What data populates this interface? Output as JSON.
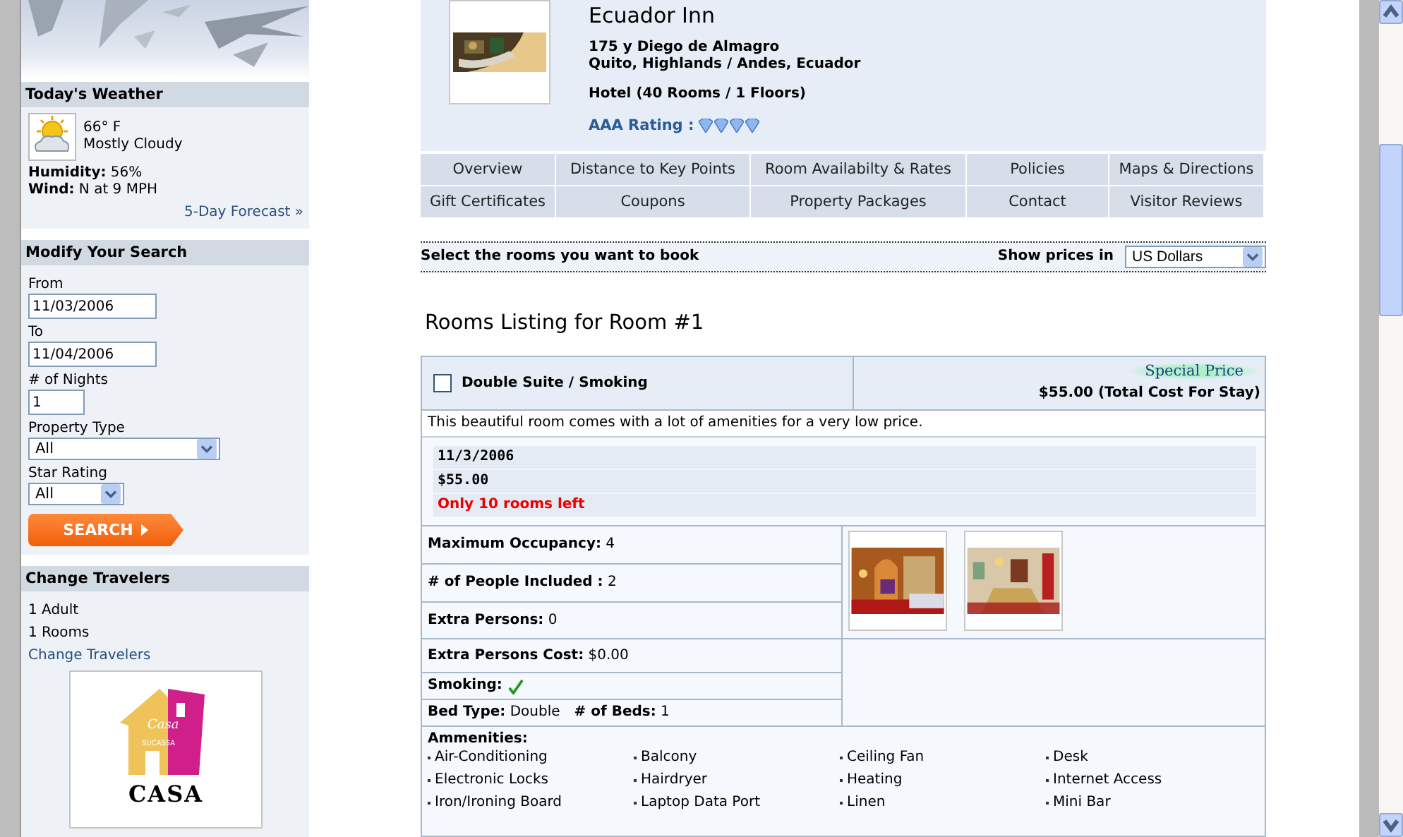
{
  "sidebar": {
    "weather": {
      "title": "Today's Weather",
      "temperature": "66° F",
      "condition": "Mostly Cloudy",
      "humidity_label": "Humidity:",
      "humidity": "56%",
      "wind_label": "Wind:",
      "wind": "N at 9 MPH",
      "forecast_link": "5-Day Forecast »"
    },
    "search": {
      "title": "Modify Your Search",
      "from_label": "From",
      "from": "11/03/2006",
      "to_label": "To",
      "to": "11/04/2006",
      "nights_label": "# of Nights",
      "nights": "1",
      "property_type_label": "Property Type",
      "property_type": "All",
      "star_rating_label": "Star Rating",
      "star_rating": "All",
      "button": "SEARCH"
    },
    "travelers": {
      "title": "Change Travelers",
      "lines": [
        "1 Adult",
        "1 Rooms"
      ],
      "link": "Change Travelers"
    },
    "ad": {
      "logo_script": "Casa",
      "logo_small": "SUCASSA",
      "logo_word": "CASA"
    }
  },
  "hotel": {
    "name": "Ecuador Inn",
    "address_lines": [
      "175 y Diego de Almagro",
      "Quito, Highlands / Andes, Ecuador"
    ],
    "summary": "Hotel (40 Rooms / 1 Floors)",
    "rating_label": "AAA Rating :",
    "stars": 4
  },
  "tabs": [
    [
      "Overview",
      "Distance to Key Points",
      "Room Availabilty & Rates",
      "Policies",
      "Maps & Directions"
    ],
    [
      "Gift Certificates",
      "Coupons",
      "Property Packages",
      "Contact",
      "Visitor Reviews"
    ]
  ],
  "booking_bar": {
    "instruction": "Select the rooms you want to book",
    "currency_label": "Show prices in",
    "currency": "US Dollars"
  },
  "listing_title": "Rooms Listing for Room #1",
  "room": {
    "name": "Double Suite / Smoking",
    "checked": false,
    "badge": "Special Price",
    "total": "$55.00 (Total Cost For Stay)",
    "description": "This beautiful room comes with a lot of amenities for a very low price.",
    "date": "11/3/2006",
    "rate": "$55.00",
    "availability": "Only 10 rooms left",
    "details": [
      {
        "kind": "text",
        "label": "Maximum Occupancy:",
        "value": "4"
      },
      {
        "kind": "text",
        "label": "# of People Included :",
        "value": "2"
      },
      {
        "kind": "text",
        "label": "Extra Persons:",
        "value": "0"
      },
      {
        "kind": "text",
        "label": "Extra Persons Cost:",
        "value": "$0.00"
      },
      {
        "kind": "check",
        "label": "Smoking:",
        "checked": true
      },
      {
        "kind": "pair",
        "label": "Bed Type:",
        "value": "Double",
        "label2": "# of Beds:",
        "value2": "1"
      }
    ],
    "amenities_title": "Ammenities:",
    "amenities": [
      "Air-Conditioning",
      "Balcony",
      "Ceiling Fan",
      "Desk",
      "Electronic Locks",
      "Hairdryer",
      "Heating",
      "Internet Access",
      "Iron/Ironing Board",
      "Laptop Data Port",
      "Linen",
      "Mini Bar"
    ]
  }
}
